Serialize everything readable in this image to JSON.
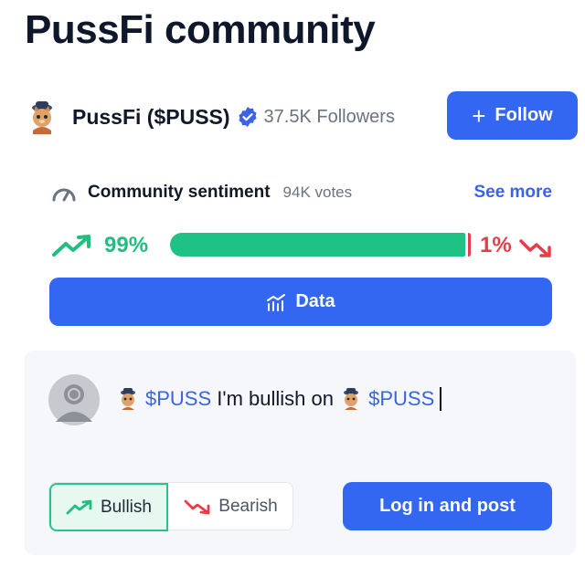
{
  "page": {
    "title": "PussFi community"
  },
  "profile": {
    "name": "PussFi ($PUSS)",
    "followers": "37.5K Followers",
    "follow_label": "Follow",
    "verified": true
  },
  "sentiment": {
    "label": "Community sentiment",
    "votes": "94K votes",
    "see_more": "See more",
    "bullish_pct_text": "99%",
    "bearish_pct_text": "1%",
    "bullish_fraction": 0.985,
    "bullish_color": "#1fc285",
    "bearish_color": "#e53e4a"
  },
  "data_button": {
    "label": "Data"
  },
  "composer": {
    "mention1": "$PUSS",
    "middle_text": " I'm bullish on ",
    "mention2": "$PUSS",
    "bullish_label": "Bullish",
    "bearish_label": "Bearish",
    "selected": "bullish",
    "post_label": "Log in and post"
  },
  "colors": {
    "accent": "#3366f1",
    "link": "#3b63e6"
  },
  "icons": [
    "puss-avatar-icon",
    "verified-badge-icon",
    "plus-icon",
    "gauge-icon",
    "trend-up-icon",
    "trend-down-icon",
    "chart-icon",
    "user-avatar-icon"
  ]
}
